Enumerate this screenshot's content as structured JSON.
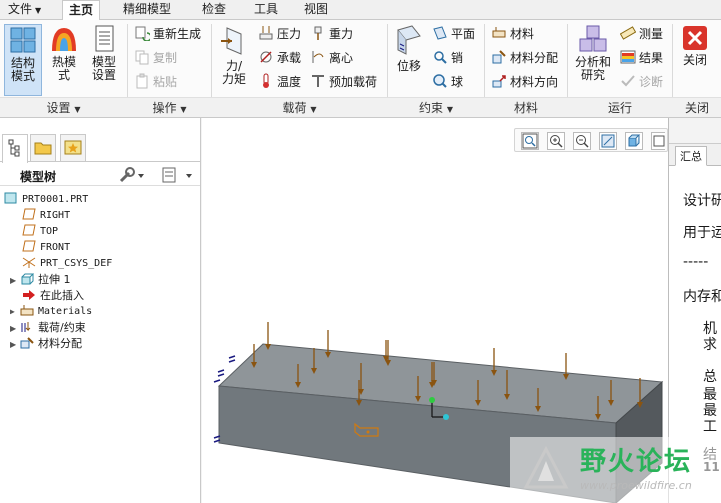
{
  "tabs": {
    "file": "文件",
    "home": "主页",
    "refine_model": "精细模型",
    "inspect": "检查",
    "tools": "工具",
    "view": "视图"
  },
  "ribbon": {
    "settings": {
      "label": "设置",
      "structure_mode": "结构\n模式",
      "thermal_mode": "热模\n式",
      "model_setup": "模型\n设置"
    },
    "operations": {
      "label": "操作",
      "regenerate": "重新生成",
      "copy": "复制",
      "paste": "粘贴"
    },
    "loads": {
      "label": "载荷",
      "force_moment": "力/\n力矩",
      "pressure": "压力",
      "gravity": "重力",
      "bearing": "承载",
      "centrifugal": "离心",
      "temperature": "温度",
      "preload": "预加载荷"
    },
    "constraints": {
      "label": "约束",
      "displacement": "位移",
      "plane": "平面",
      "pin": "销",
      "ball": "球"
    },
    "materials": {
      "label": "材料",
      "material": "材料",
      "material_assignment": "材料分配",
      "material_orientation": "材料方向"
    },
    "run": {
      "label": "运行",
      "analysis_studies": "分析和\n研究",
      "measure": "测量",
      "results": "结果",
      "diagnostics": "诊断"
    },
    "close": {
      "label": "关闭",
      "close": "关闭"
    }
  },
  "model_tree": {
    "title": "模型树",
    "items": [
      {
        "label": "PRT0001.PRT",
        "icon": "part-icon"
      },
      {
        "label": "RIGHT",
        "icon": "datum-plane-icon"
      },
      {
        "label": "TOP",
        "icon": "datum-plane-icon"
      },
      {
        "label": "FRONT",
        "icon": "datum-plane-icon"
      },
      {
        "label": "PRT_CSYS_DEF",
        "icon": "csys-icon"
      },
      {
        "label": "拉伸 1",
        "icon": "extrude-icon"
      },
      {
        "label": "在此插入",
        "icon": "insert-arrow-icon"
      },
      {
        "label": "Materials",
        "icon": "materials-icon"
      },
      {
        "label": "载荷/约束",
        "icon": "loads-constraints-icon"
      },
      {
        "label": "材料分配",
        "icon": "material-assignment-icon"
      }
    ]
  },
  "summary_panel": {
    "tab_label": "汇总",
    "lines": [
      "设计研",
      "用于运",
      "-----",
      "内存和",
      "机",
      "求",
      "总",
      "最",
      "最",
      "工",
      "结",
      "11"
    ]
  },
  "watermark": {
    "text": "野火论坛",
    "url": "www.proewildfire.cn"
  },
  "colors": {
    "ribbon_bg": "#fbfbfb",
    "selected_btn": "#cfe3f7",
    "block_top": "#8f9599",
    "block_front": "#6f767b",
    "block_right": "#565c60",
    "load_arrow": "#8a5410",
    "constraint": "#1a1a80"
  }
}
